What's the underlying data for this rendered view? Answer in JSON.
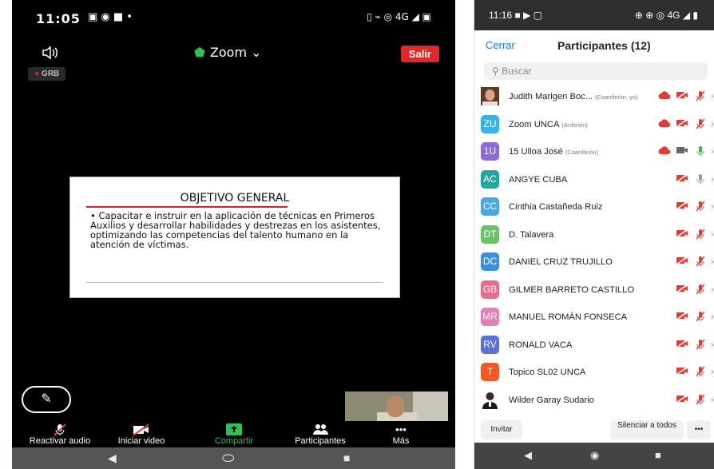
{
  "left": {
    "status_time": "11:05",
    "status_icons": "▣ ◉ ■ •",
    "status_sys": "▯ ⌁ ◎ 4G ◢ ▣",
    "speaker_icon": "speaker-icon",
    "meeting_title": "Zoom",
    "chevron": "⌄",
    "shield_icon": "⬟",
    "salir": "Salir",
    "recording_badge": "GRB",
    "slide": {
      "title": "OBJETIVO GENERAL",
      "body": "• Capacitar e instruir en la aplicación de técnicas en Primeros Auxilios y desarrollar habilidades y destrezas en los asistentes, optimizando las competencias del talento humano en la atención de víctimas."
    },
    "toolbar": [
      {
        "label": "Reactivar audio",
        "icon": "muted-mic-icon",
        "glyph": "🎙"
      },
      {
        "label": "Iniciar video",
        "icon": "camera-off-icon",
        "glyph": "▰"
      },
      {
        "label": "Compartir",
        "icon": "share-icon",
        "glyph": "⬆"
      },
      {
        "label": "Participantes",
        "icon": "participants-icon",
        "glyph": "👥"
      },
      {
        "label": "Más",
        "icon": "more-icon",
        "glyph": "•••"
      }
    ],
    "nav": {
      "back": "◀",
      "home": "⬭",
      "recent": "■"
    }
  },
  "right": {
    "status_time": "11:16",
    "status_icons": "■ ▶ ▢",
    "status_sys": "⊕ ⊕ ◎ 4G ◢ ▮",
    "close": "Cerrar",
    "title": "Participantes (12)",
    "search_placeholder": "Buscar",
    "participants": [
      {
        "initials": "",
        "avatar_color": "#5a3b2a",
        "name": "Judith Marigen Boc...",
        "role": "(Coanfitrión, yo)",
        "cloud": true,
        "cam_off": true,
        "mic": "muted"
      },
      {
        "initials": "ZU",
        "avatar_color": "#34b4e4",
        "name": "Zoom UNCA",
        "role": "(Anfitrión)",
        "cloud": true,
        "cam_off": true,
        "mic": "muted"
      },
      {
        "initials": "1U",
        "avatar_color": "#8e6bd8",
        "name": "15 Ulloa José",
        "role": "(Coanfitrión)",
        "cloud": true,
        "cam_off": false,
        "mic": "on"
      },
      {
        "initials": "AC",
        "avatar_color": "#21a7a0",
        "name": "ANGYE CUBA",
        "role": "",
        "cloud": false,
        "cam_off": true,
        "mic": "silent"
      },
      {
        "initials": "CC",
        "avatar_color": "#4aa8e0",
        "name": "Cinthia Castañeda Ruiz",
        "role": "",
        "cloud": false,
        "cam_off": true,
        "mic": "muted"
      },
      {
        "initials": "DT",
        "avatar_color": "#6dc06a",
        "name": "D. Talavera",
        "role": "",
        "cloud": false,
        "cam_off": true,
        "mic": "muted"
      },
      {
        "initials": "DC",
        "avatar_color": "#3b8fe0",
        "name": "DANIEL CRUZ TRUJILLO",
        "role": "",
        "cloud": false,
        "cam_off": true,
        "mic": "muted"
      },
      {
        "initials": "GB",
        "avatar_color": "#e86d8d",
        "name": "GILMER BARRETO CASTILLO",
        "role": "",
        "cloud": false,
        "cam_off": true,
        "mic": "muted"
      },
      {
        "initials": "MR",
        "avatar_color": "#e27fb4",
        "name": "MANUEL ROMÁN FONSECA",
        "role": "",
        "cloud": false,
        "cam_off": true,
        "mic": "muted"
      },
      {
        "initials": "RV",
        "avatar_color": "#5a6fd8",
        "name": "RONALD VACA",
        "role": "",
        "cloud": false,
        "cam_off": true,
        "mic": "muted"
      },
      {
        "initials": "T",
        "avatar_color": "#f25a23",
        "name": "Topico SL02 UNCA",
        "role": "",
        "cloud": false,
        "cam_off": true,
        "mic": "muted"
      },
      {
        "initials": "",
        "avatar_color": "#ffffff",
        "name": "Wilder Garay Sudario",
        "role": "",
        "cloud": false,
        "cam_off": true,
        "mic": "muted"
      }
    ],
    "invite": "Invitar",
    "mute_all": "Silenciar a todos",
    "more": "•••",
    "nav": {
      "back": "◀",
      "home": "◉",
      "recent": "■"
    }
  }
}
